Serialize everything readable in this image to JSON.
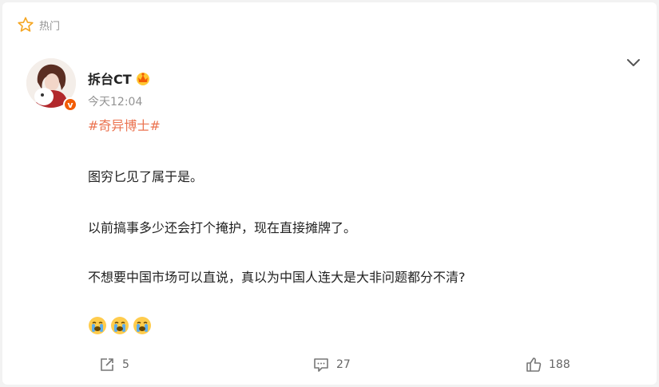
{
  "header": {
    "hot_label": "热门"
  },
  "post": {
    "username": "拆台CT",
    "time": "今天12:04",
    "topic": "#奇异博士#",
    "verified_badge": "v",
    "paragraphs": [
      "图穷匕见了属于是。",
      "以前搞事多少还会打个掩护，现在直接摊牌了。",
      "不想要中国市场可以直说，真以为中国人连大是大非问题都分不清?"
    ],
    "emojis": [
      "crying-face",
      "crying-face",
      "crying-face"
    ]
  },
  "actions": {
    "share_count": "5",
    "comment_count": "27",
    "like_count": "188"
  },
  "colors": {
    "accent": "#eb7350",
    "hot_star": "#f5a623",
    "badge": "#f25c05",
    "muted": "#939393"
  },
  "icons": [
    "star-icon",
    "crown-icon",
    "chevron-down-icon",
    "share-icon",
    "comment-icon",
    "like-icon"
  ]
}
